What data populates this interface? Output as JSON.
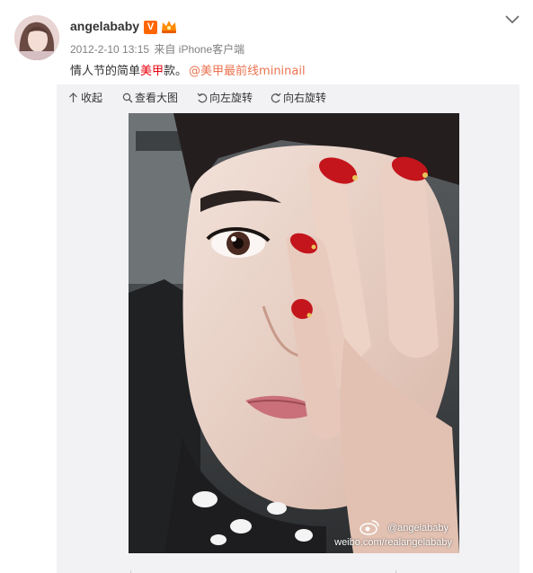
{
  "post": {
    "username": "angelababy",
    "verified_badge": "V",
    "timestamp": "2012-2-10 13:15",
    "source_prefix": "来自",
    "source": "iPhone客户端",
    "text_before": "情人节的简单",
    "text_highlight": "美甲",
    "text_after": "款。",
    "mention_at": "@",
    "mention": "美甲最前线mininail"
  },
  "toolbar": {
    "collapse": "收起",
    "view_large": "查看大图",
    "rotate_left": "向左旋转",
    "rotate_right": "向右旋转"
  },
  "photo": {
    "watermark_handle": "@angelababy",
    "watermark_url": "weibo.com/realangelababy"
  },
  "colors": {
    "accent_link": "#eb7350",
    "highlight_red": "#e8000d",
    "verified_orange": "#ff6600",
    "meta_gray": "#808080",
    "media_bg": "#f2f2f5"
  },
  "icons": [
    "chevron-down-icon",
    "crown-icon",
    "collapse-up-icon",
    "magnifier-icon",
    "rotate-left-icon",
    "rotate-right-icon",
    "weibo-eye-icon"
  ]
}
